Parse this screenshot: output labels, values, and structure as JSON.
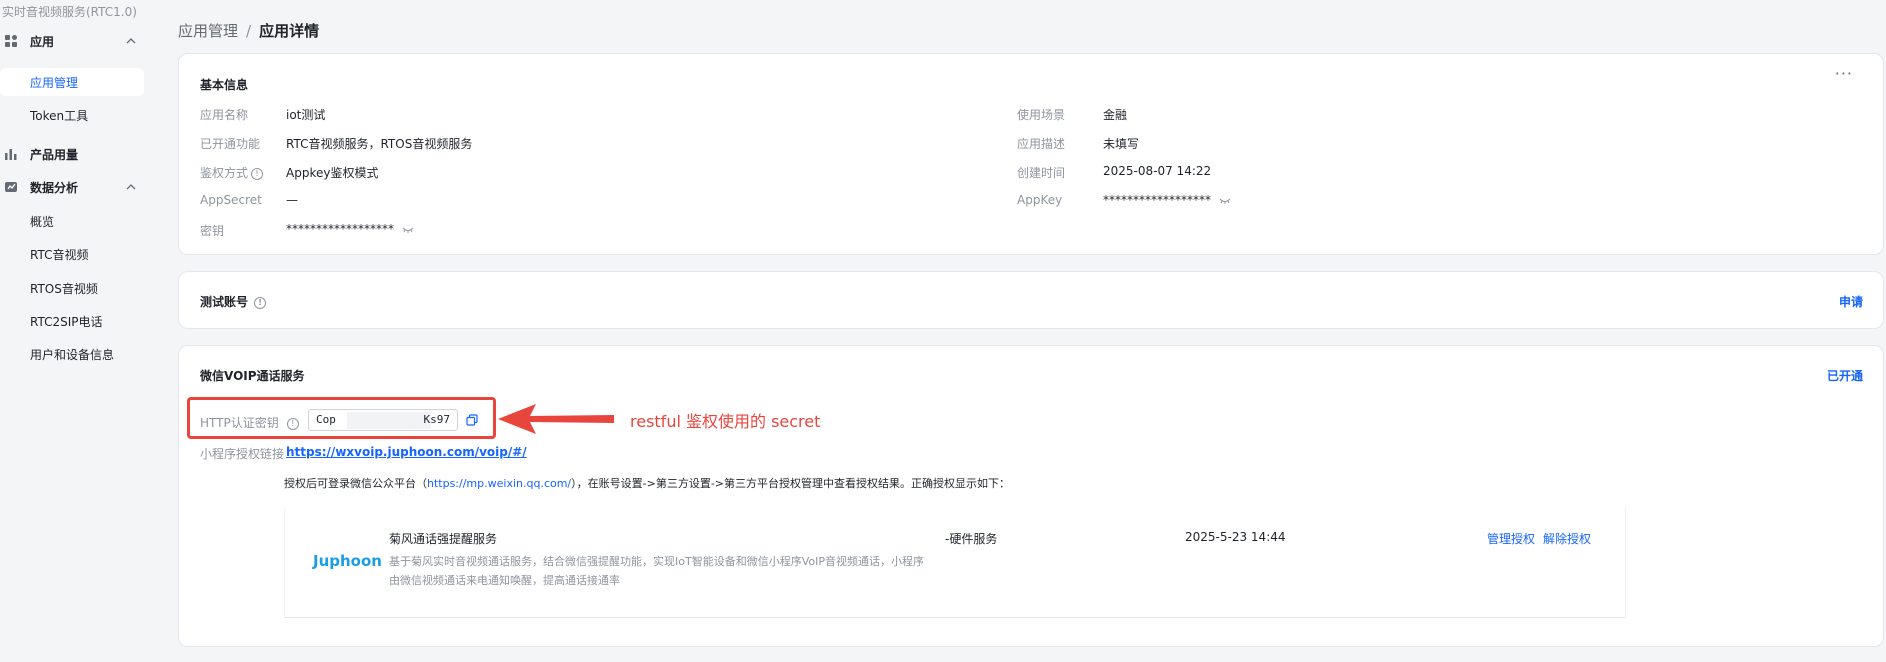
{
  "sidebar": {
    "top_title": "实时音视频服务(RTC1.0)",
    "groups": [
      {
        "label": "应用",
        "icon": "apps-icon"
      },
      {
        "label": "产品用量",
        "icon": "bar-chart-icon"
      },
      {
        "label": "数据分析",
        "icon": "data-analysis-icon"
      }
    ],
    "app_items": [
      "应用管理",
      "Token工具"
    ],
    "data_items": [
      "概览",
      "RTC音视频",
      "RTOS音视频",
      "RTC2SIP电话",
      "用户和设备信息"
    ]
  },
  "breadcrumb": {
    "parent": "应用管理",
    "separator": "/",
    "current": "应用详情"
  },
  "basic_info": {
    "title": "基本信息",
    "more": "···",
    "left": [
      {
        "label": "应用名称",
        "value": "iot测试"
      },
      {
        "label": "已开通功能",
        "value": "RTC音视频服务，RTOS音视频服务"
      },
      {
        "label": "鉴权方式",
        "value": "Appkey鉴权模式"
      },
      {
        "label": "AppSecret",
        "value": "—"
      },
      {
        "label": "密钥",
        "value": "******************"
      }
    ],
    "right": [
      {
        "label": "使用场景",
        "value": "金融"
      },
      {
        "label": "应用描述",
        "value": "未填写"
      },
      {
        "label": "创建时间",
        "value": "2025-08-07 14:22"
      },
      {
        "label": "AppKey",
        "value": "******************"
      }
    ]
  },
  "test_account": {
    "title": "测试账号",
    "action": "申请"
  },
  "voip": {
    "title": "微信VOIP通话服务",
    "status": "已开通",
    "secret_label": "HTTP认证密钥",
    "secret_prefix": "Cop",
    "secret_suffix": "Ks97",
    "miniprogram_label": "小程序授权链接",
    "miniprogram_link": "https://wxvoip.juphoon.com/voip/#/",
    "hint_before": "授权后可登录微信公众平台（",
    "hint_link": "https://mp.weixin.qq.com/",
    "hint_after": "），在账号设置->第三方设置->第三方平台授权管理中查看授权结果。正确授权显示如下：",
    "service": {
      "logo": "Juphoon",
      "name": "菊风通话强提醒服务",
      "desc": "基于菊风实时音视频通话服务，结合微信强提醒功能，实现IoT智能设备和微信小程序VoIP音视频通话，小程序由微信视频通话来电通知唤醒，提高通话接通率",
      "type": "-硬件服务",
      "time": "2025-5-23 14:44",
      "manage": "管理授权",
      "revoke": "解除授权"
    }
  },
  "annotation": "restful 鉴权使用的 secret",
  "colors": {
    "accent": "#1664ff",
    "annotation_red": "#e8453c",
    "logo_blue": "#1a9de4"
  }
}
